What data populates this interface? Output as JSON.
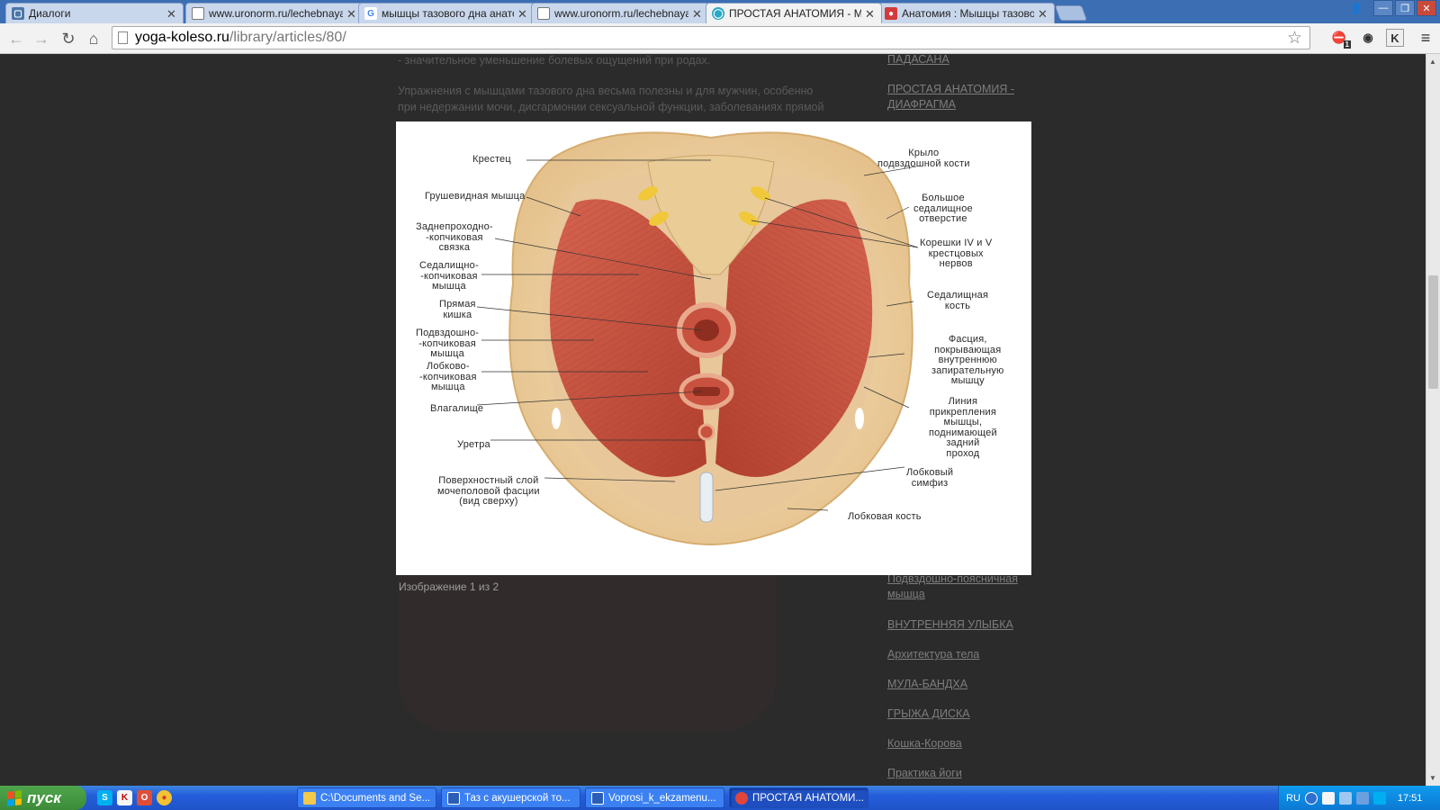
{
  "browser": {
    "tabs": [
      {
        "label": "Диалоги",
        "icon": "chat-icon",
        "color": "#4a76a8",
        "active": false
      },
      {
        "label": "www.uronorm.ru/lechebnaya",
        "icon": "page-icon",
        "color": "#ffffff",
        "active": false
      },
      {
        "label": "мышцы тазового дна анато",
        "icon": "google-icon",
        "color": "#ffffff",
        "active": false
      },
      {
        "label": "www.uronorm.ru/lechebnaya",
        "icon": "page-icon",
        "color": "#ffffff",
        "active": false
      },
      {
        "label": "ПРОСТАЯ АНАТОМИЯ - МЫШ",
        "icon": "site-icon",
        "color": "#2aa8c8",
        "active": true
      },
      {
        "label": "Анатомия : Мышцы тазово",
        "icon": "site-icon",
        "color": "#d33b3b",
        "active": false
      }
    ],
    "url": {
      "host": "yoga-koleso.ru",
      "path": "/library/articles/80/"
    },
    "extensions": {
      "badge": "1",
      "k_label": "K"
    }
  },
  "article": {
    "paragraph_1": "- значительное уменьшение болевых ощущений при родах.",
    "paragraph_2_line1": "Упражнения с мышцами тазового дна весьма полезны и для мужчин, особенно",
    "paragraph_2_line2": "при недержании мочи, дисгармонии сексуальной функции, заболеваниях прямой"
  },
  "sidebar": {
    "links": [
      "ПАДАСАНА",
      "ПРОСТАЯ АНАТОМИЯ - ДИАФРАГМА",
      "Подвздошно-поясничная мышца",
      "ВНУТРЕННЯЯ УЛЫБКА",
      "Архитектура тела",
      "МУЛА-БАНДХА",
      "ГРЫЖА ДИСКА",
      "Кошка-Корова",
      "Практика йоги"
    ]
  },
  "lightbox": {
    "caption": "Изображение 1 из 2",
    "labels": {
      "sacrum": "Крестец",
      "iliac_wing": "Крыло\nподвздошной кости",
      "piriformis": "Грушевидная мышца",
      "greater_sciatic": "Большое\nседалищное\nотверстие",
      "anococcygeal": "Заднепроходно-\n-копчиковая\nсвязка",
      "nerve_roots": "Корешки IV и V\nкрестцовых\nнервов",
      "ischiococcygeus": "Седалищно-\n-копчиковая\nмышца",
      "ischium": "Седалищная\nкость",
      "rectum": "Прямая\nкишка",
      "fascia": "Фасция,\nпокрывающая\nвнутреннюю\nзапирательную\nмышцу",
      "iliococcygeus": "Подвздошно-\n-копчиковая\nмышца",
      "pubococcygeus": "Лобково-\n-копчиковая\nмышца",
      "levator_line": "Линия\nприкрепления\nмышцы,\nподнимающей\nзадний\nпроход",
      "vagina": "Влагалище",
      "urethra": "Уретра",
      "pubic_symphysis": "Лобковый\nсимфиз",
      "superficial_fascia": "Поверхностный слой\nмочеполовой фасции\n(вид сверху)",
      "pubic_bone": "Лобковая кость"
    }
  },
  "taskbar": {
    "start_label": "пуск",
    "tasks": [
      {
        "label": "C:\\Documents and Se...",
        "color": "#f3c94b",
        "active": false
      },
      {
        "label": "Таз с акушерской то...",
        "color": "#2b5fb6",
        "active": false
      },
      {
        "label": "Voprosi_k_ekzamenu...",
        "color": "#2b5fb6",
        "active": false
      },
      {
        "label": "ПРОСТАЯ АНАТОМИ...",
        "color": "#e0463a",
        "active": true
      }
    ],
    "lang": "RU",
    "clock": "17:51"
  },
  "colors": {
    "accent": "#3c6eb4",
    "taskbar": "#245edb",
    "start": "#3c8b39",
    "muscle": "#c8523f",
    "bone": "#ecd3a4"
  }
}
